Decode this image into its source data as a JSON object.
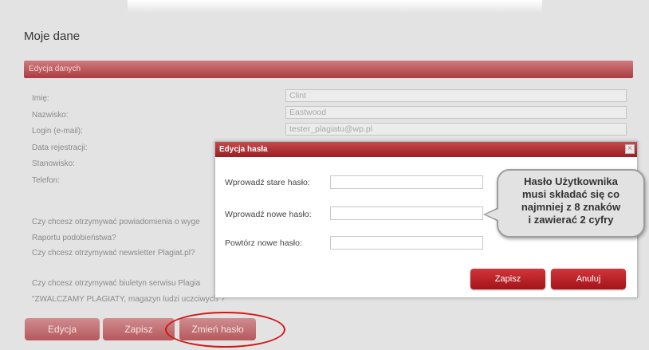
{
  "page": {
    "title": "Moje dane"
  },
  "panel": {
    "header": "Edycja danych",
    "fields": [
      {
        "label": "Imię:",
        "value": "Clint"
      },
      {
        "label": "Nazwisko:",
        "value": "Eastwood"
      },
      {
        "label": "Login (e-mail):",
        "value": "tester_plagiatu@wp.pl"
      },
      {
        "label": "Data rejestracji:"
      },
      {
        "label": "Stanowisko:"
      },
      {
        "label": "Telefon:"
      }
    ],
    "questions": [
      "Czy chcesz otrzymywać powiadomienia o wyge",
      "Raportu podobieństwa?",
      "Czy chcesz otrzymywać newsletter Plagiat.pl?",
      "Czy chcesz otrzymywać biuletyn serwisu Plagia",
      "\"ZWALCZAMY PLAGIATY, magazyn ludzi uczciwych\"?"
    ]
  },
  "buttons": {
    "edit": "Edycja",
    "save": "Zapisz",
    "change_password": "Zmień hasło"
  },
  "modal": {
    "title": "Edycja hasła",
    "close": "×",
    "old_password_label": "Wprowadź stare hasło:",
    "new_password_label": "Wprowadź nowe hasło:",
    "repeat_password_label": "Powtórz nowe hasło:",
    "save": "Zapisz",
    "cancel": "Anuluj"
  },
  "tooltip": {
    "lines": [
      "Hasło Użytkownika",
      "musi składać się co",
      "najmniej z 8 znaków",
      "i zawierać 2 cyfry"
    ]
  },
  "colors": {
    "accent": "#a51318",
    "header_dim": "#b6585c",
    "highlight_ring": "#d41414"
  }
}
